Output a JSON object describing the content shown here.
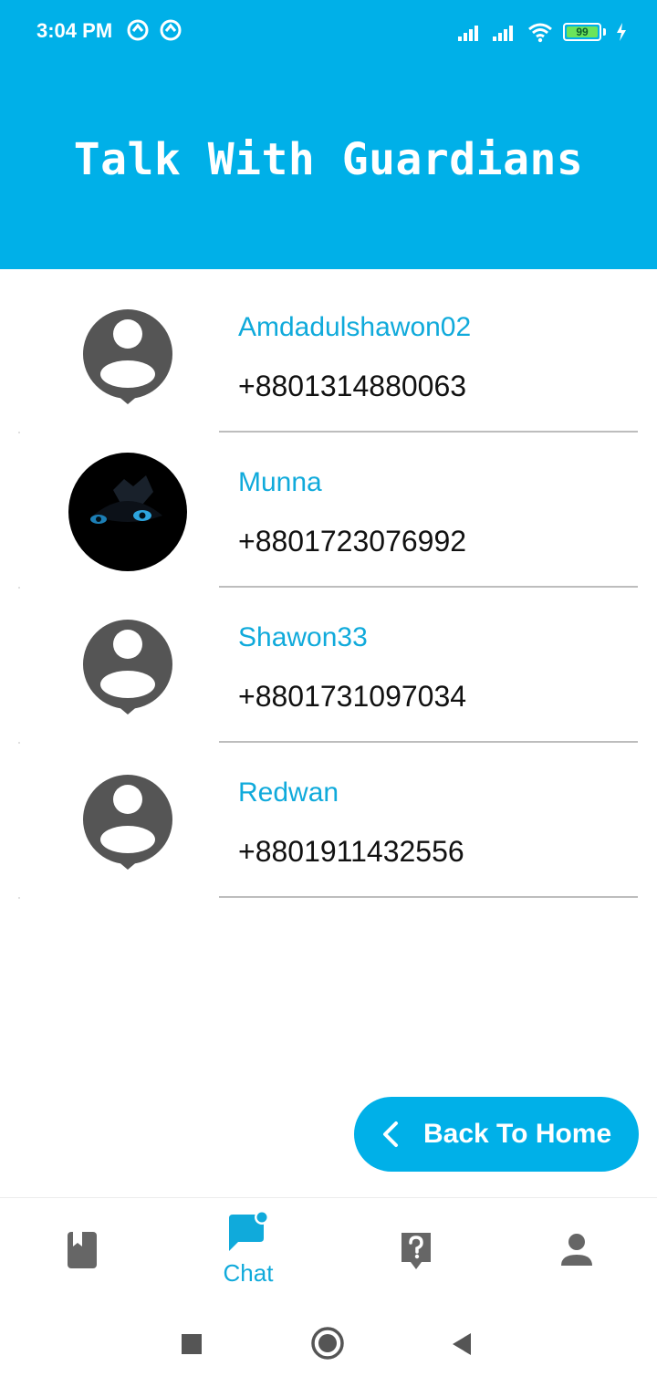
{
  "status_bar": {
    "time": "3:04 PM",
    "battery": "99"
  },
  "header": {
    "title": "Talk With Guardians"
  },
  "guardians": [
    {
      "name": "Amdadulshawon02",
      "phone": "+8801314880063",
      "avatar": "default-avatar-icon"
    },
    {
      "name": "Munna",
      "phone": "+8801723076992",
      "avatar": "profile-photo"
    },
    {
      "name": "Shawon33",
      "phone": "+8801731097034",
      "avatar": "default-avatar-icon"
    },
    {
      "name": "Redwan",
      "phone": "+8801911432556",
      "avatar": "default-avatar-icon"
    }
  ],
  "actions": {
    "back_label": "Back To Home"
  },
  "bottom_nav": {
    "items": [
      {
        "icon": "book-icon",
        "label": ""
      },
      {
        "icon": "chat-icon",
        "label": "Chat",
        "active": true
      },
      {
        "icon": "help-icon",
        "label": ""
      },
      {
        "icon": "profile-icon",
        "label": ""
      }
    ]
  },
  "colors": {
    "accent": "#00B0E8",
    "name_text": "#10AADB",
    "icon_gray": "#666666"
  }
}
